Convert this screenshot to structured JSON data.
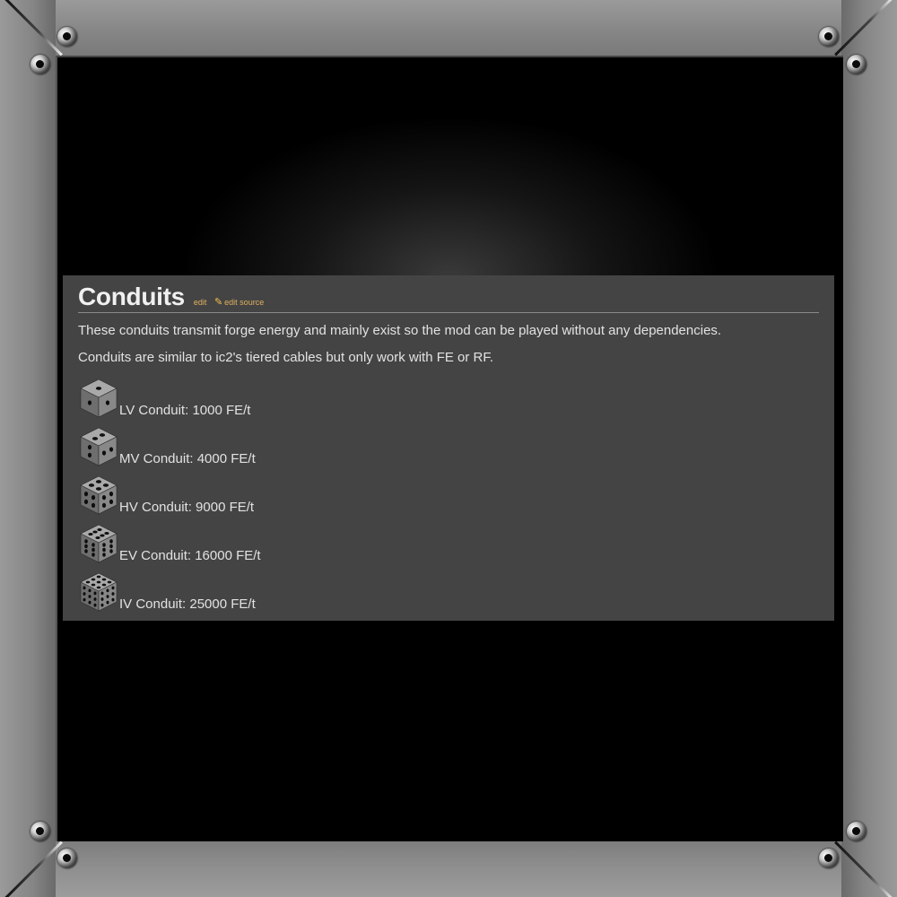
{
  "page": {
    "title": "Conduits",
    "edit_link": "edit",
    "edit_source_link": "edit source",
    "intro": "These conduits transmit forge energy and mainly exist so the mod can be played without any dependencies.",
    "note": "Conduits are similar to ic2's tiered cables but only work with FE or RF."
  },
  "conduits": [
    {
      "label": "LV Conduit: 1000 FE/t",
      "icon": "lv-conduit-icon",
      "holes": 1
    },
    {
      "label": "MV Conduit: 4000 FE/t",
      "icon": "mv-conduit-icon",
      "holes": 2
    },
    {
      "label": "HV Conduit: 9000 FE/t",
      "icon": "hv-conduit-icon",
      "holes": 4
    },
    {
      "label": "EV Conduit: 16000 FE/t",
      "icon": "ev-conduit-icon",
      "holes": 6
    },
    {
      "label": "IV Conduit: 25000 FE/t",
      "icon": "iv-conduit-icon",
      "holes": 9
    }
  ],
  "colors": {
    "panel": "#444444",
    "text": "#e2e2e2",
    "link": "#e0b060",
    "frame": "#858585"
  }
}
